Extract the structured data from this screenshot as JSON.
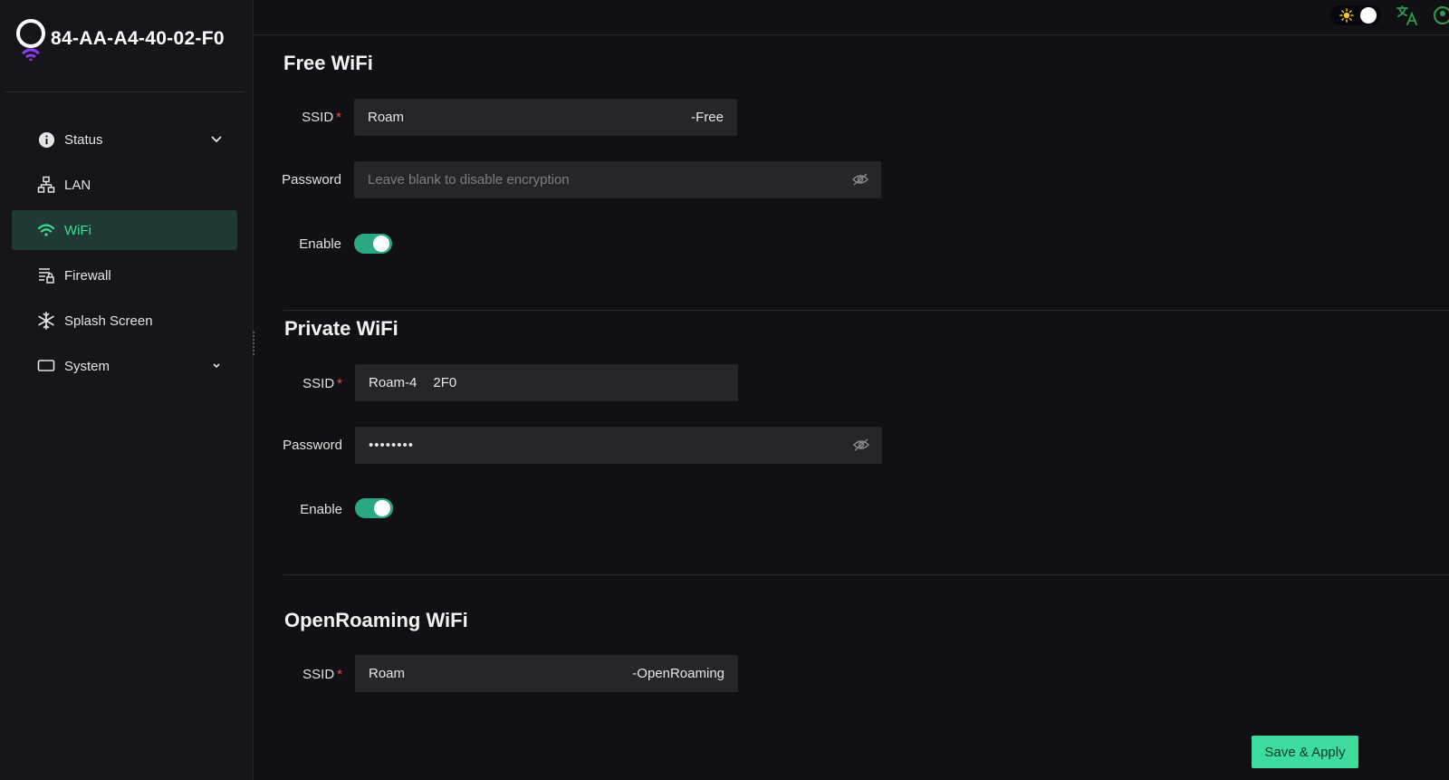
{
  "brand": {
    "title": "84-AA-A4-40-02-F0"
  },
  "colors": {
    "accent": "#3ddc97",
    "active_bg": "#1f3a34",
    "toggle_on": "#2aa883",
    "required": "#e44f4f"
  },
  "nav": {
    "items": [
      {
        "label": "Status",
        "icon": "info-icon",
        "has_chevron": true
      },
      {
        "label": "LAN",
        "icon": "network-icon",
        "has_chevron": false
      },
      {
        "label": "WiFi",
        "icon": "wifi-icon",
        "has_chevron": false,
        "active": true
      },
      {
        "label": "Firewall",
        "icon": "firewall-icon",
        "has_chevron": false
      },
      {
        "label": "Splash Screen",
        "icon": "snowflake-icon",
        "has_chevron": false
      },
      {
        "label": "System",
        "icon": "monitor-icon",
        "has_chevron": true
      }
    ]
  },
  "topbar": {
    "theme_icon": "sun-icon",
    "translate_icon": "translate-icon",
    "user_icon": "user-icon"
  },
  "free_wifi": {
    "title": "Free WiFi",
    "ssid_label": "SSID",
    "ssid_value": "Roam",
    "ssid_suffix": "-Free",
    "password_label": "Password",
    "password_placeholder": "Leave blank to disable encryption",
    "enable_label": "Enable",
    "enabled": true
  },
  "private_wifi": {
    "title": "Private WiFi",
    "ssid_label": "SSID",
    "ssid_value": "Roam-4      2F0",
    "password_label": "Password",
    "password_value": "••••••••",
    "enable_label": "Enable",
    "enabled": true
  },
  "openroaming_wifi": {
    "title": "OpenRoaming WiFi",
    "ssid_label": "SSID",
    "ssid_value": "Roam",
    "ssid_suffix": "-OpenRoaming"
  },
  "required_mark": "*",
  "actions": {
    "save_label": "Save & Apply"
  }
}
